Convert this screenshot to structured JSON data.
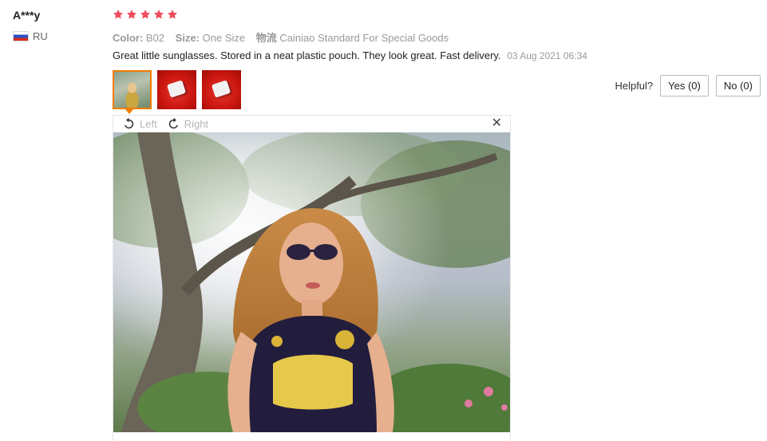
{
  "review": {
    "user": {
      "name": "A***y",
      "country": "RU"
    },
    "rating": 5,
    "meta": {
      "color_label": "Color:",
      "color_value": "B02",
      "size_label": "Size:",
      "size_value": "One Size",
      "shipping_label": "物流",
      "shipping_value": "Cainiao Standard For Special Goods"
    },
    "text": "Great little sunglasses. Stored in a neat plastic pouch. They look great. Fast delivery.",
    "date": "03 Aug 2021 06:34",
    "helpful": {
      "label": "Helpful?",
      "yes": "Yes (0)",
      "no": "No (0)"
    }
  },
  "viewer": {
    "rotate_left": "Left",
    "rotate_right": "Right",
    "close": "✕"
  },
  "colors": {
    "star": "#f04c5c",
    "active_thumb_border": "#f27d00"
  },
  "icons": [
    "russia-flag-icon",
    "star-icon",
    "rotate-left-icon",
    "rotate-right-icon",
    "close-icon"
  ]
}
